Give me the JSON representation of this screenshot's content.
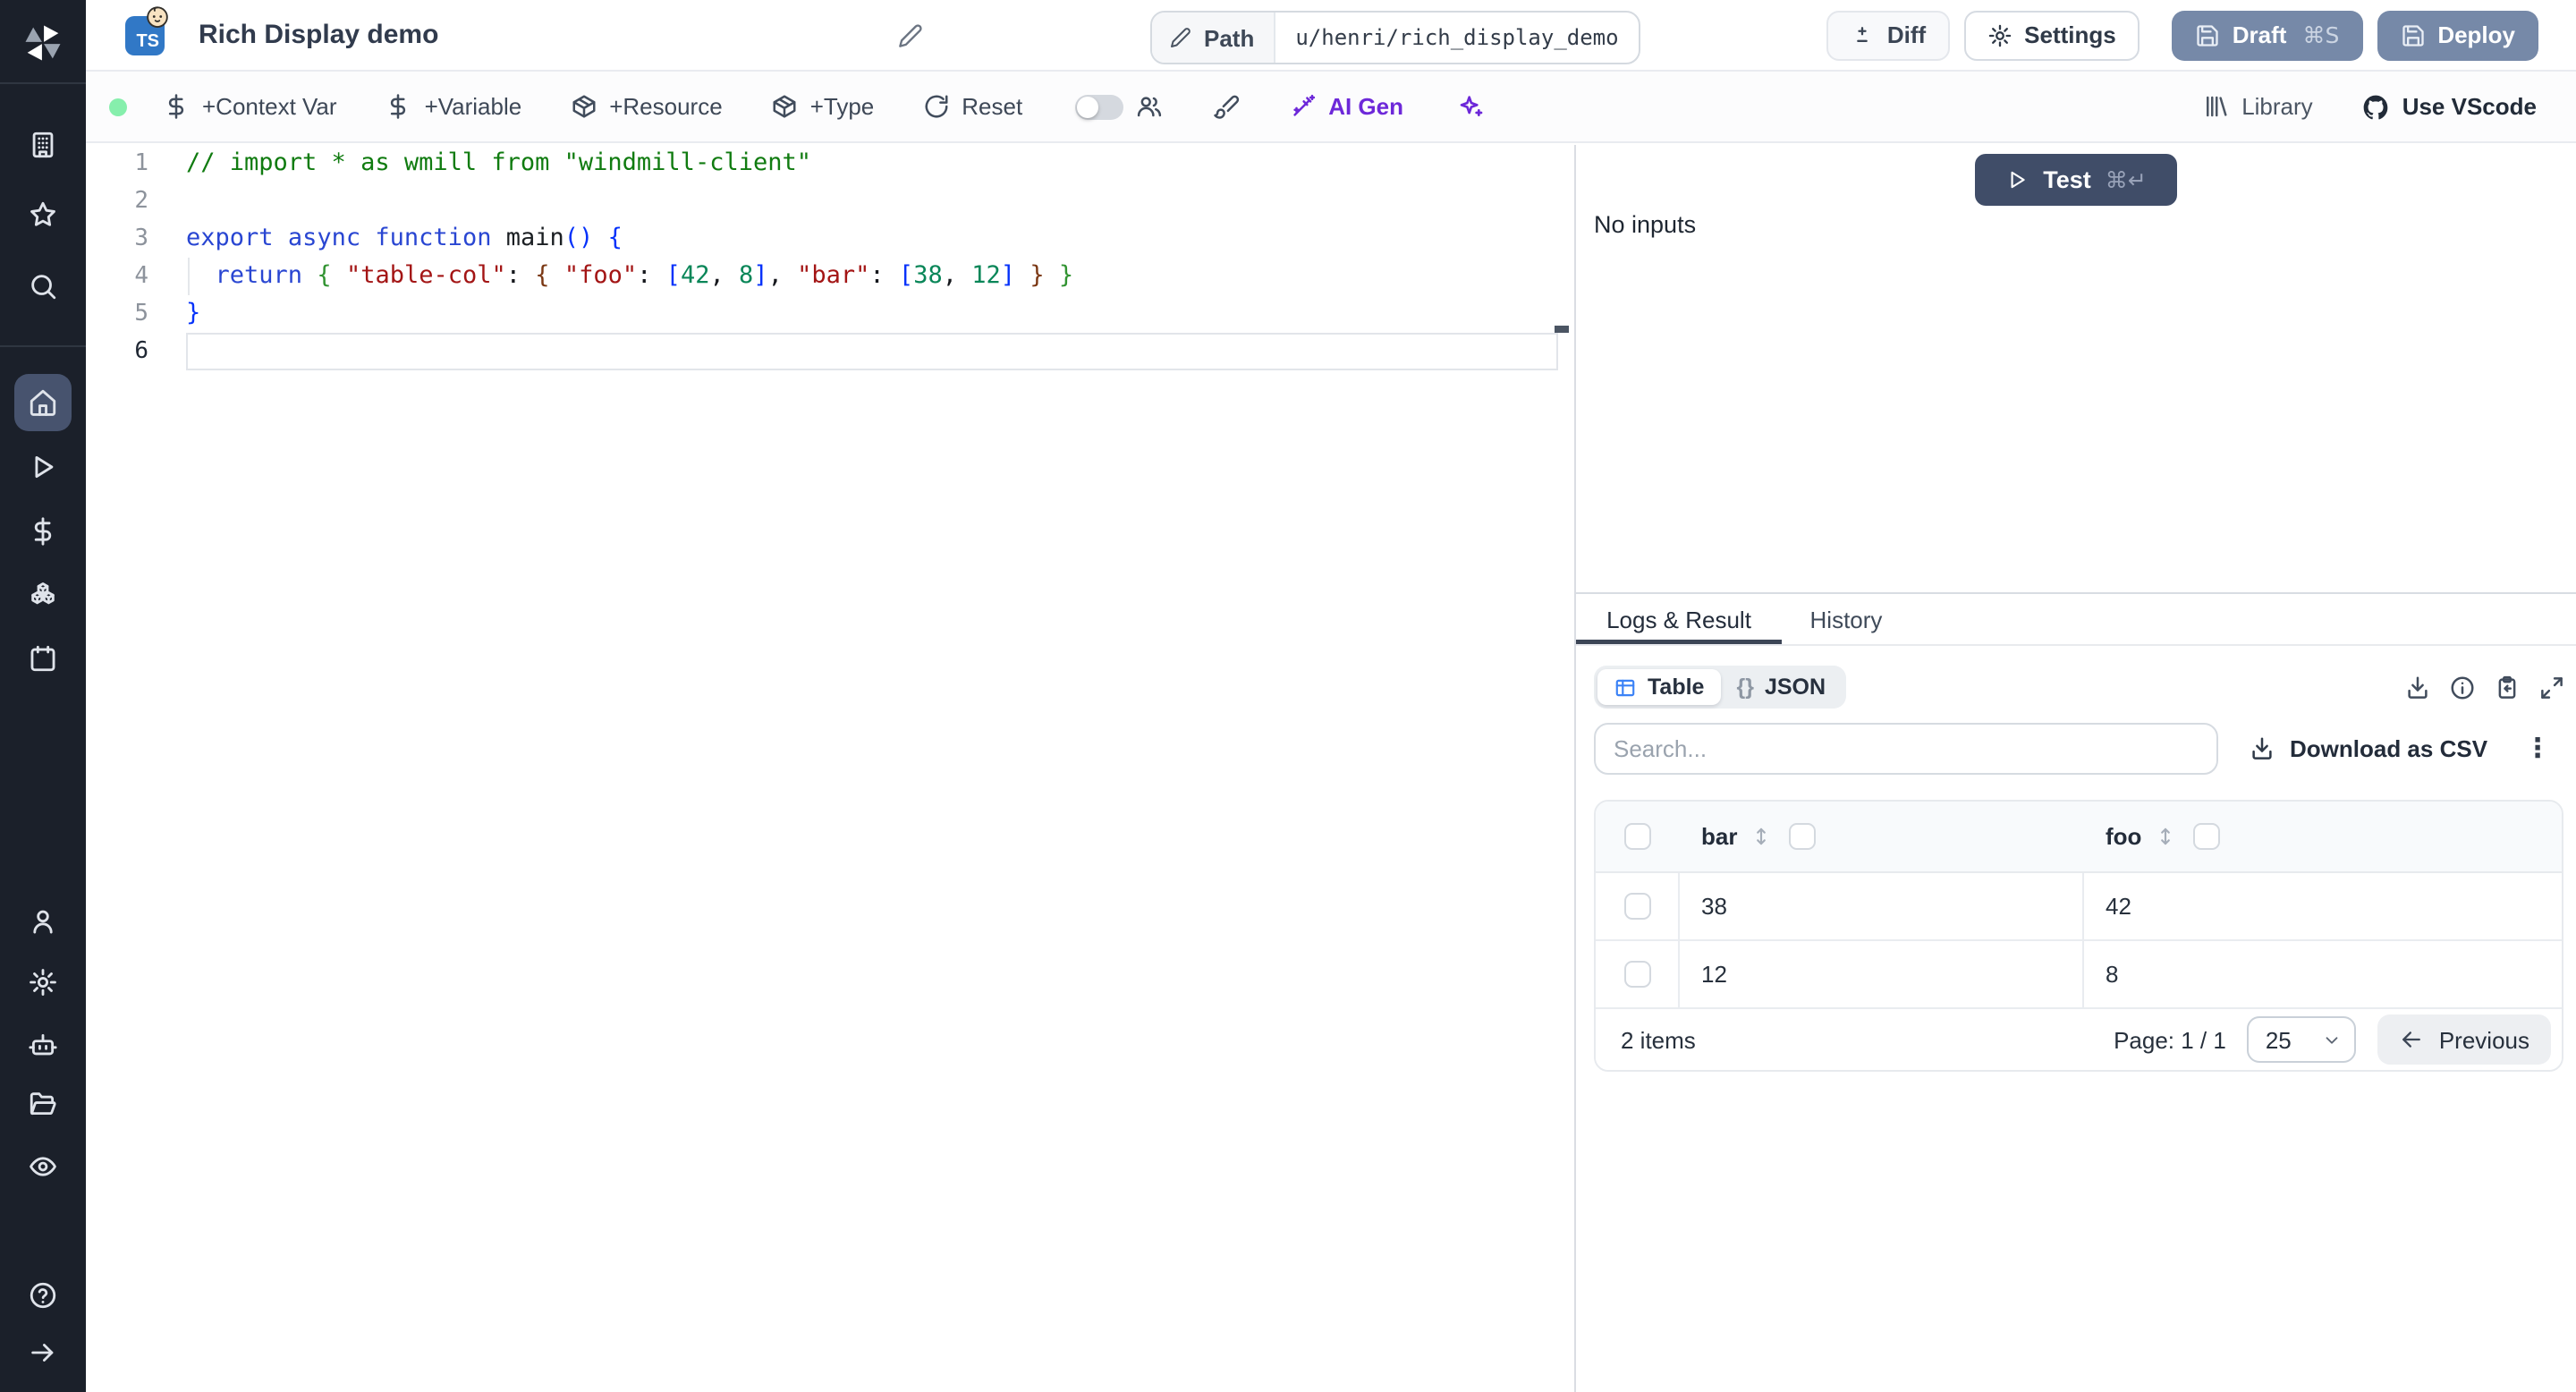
{
  "colors": {
    "sidebar_bg": "#1b202a",
    "slate": "#7689a8",
    "navy": "#404d68",
    "purple": "#6d28d9",
    "green_dot": "#86efac",
    "ts_blue": "#3178c6",
    "table_blue": "#3b82f6"
  },
  "sidebar": {
    "items": [
      {
        "icon": "logo",
        "name": "windmill-logo"
      },
      {
        "icon": "building",
        "name": "sidebar-item-workspace"
      },
      {
        "icon": "star",
        "name": "sidebar-item-favorites"
      },
      {
        "icon": "search",
        "name": "sidebar-item-search"
      },
      {
        "icon": "home",
        "name": "sidebar-item-home",
        "active": true
      },
      {
        "icon": "play",
        "name": "sidebar-item-runs"
      },
      {
        "icon": "dollar",
        "name": "sidebar-item-variables"
      },
      {
        "icon": "boxes",
        "name": "sidebar-item-resources"
      },
      {
        "icon": "calendar",
        "name": "sidebar-item-schedules"
      },
      {
        "icon": "user",
        "name": "sidebar-item-users"
      },
      {
        "icon": "gear",
        "name": "sidebar-item-settings"
      },
      {
        "icon": "bot",
        "name": "sidebar-item-workers"
      },
      {
        "icon": "folder-open",
        "name": "sidebar-item-folders"
      },
      {
        "icon": "eye",
        "name": "sidebar-item-audit-logs"
      },
      {
        "icon": "help",
        "name": "sidebar-item-help"
      },
      {
        "icon": "arrow-right",
        "name": "sidebar-item-expand"
      }
    ]
  },
  "header": {
    "language_badge": "TS",
    "title": "Rich Display demo",
    "path_label": "Path",
    "path_value": "u/henri/rich_display_demo",
    "diff": "Diff",
    "settings": "Settings",
    "draft": "Draft",
    "draft_shortcut": "⌘S",
    "deploy": "Deploy"
  },
  "toolbar": {
    "context_var": "+Context Var",
    "variable": "+Variable",
    "resource": "+Resource",
    "type": "+Type",
    "reset": "Reset",
    "ai_gen": "AI Gen",
    "library": "Library",
    "use_vscode": "Use VScode"
  },
  "editor": {
    "active_line": 6,
    "lines": [
      {
        "segs": [
          [
            "c",
            "// import * as wmill from \"windmill-client\""
          ]
        ]
      },
      {
        "segs": []
      },
      {
        "segs": [
          [
            "k",
            "export"
          ],
          [
            "p",
            " "
          ],
          [
            "k",
            "async"
          ],
          [
            "p",
            " "
          ],
          [
            "k",
            "function"
          ],
          [
            "p",
            " "
          ],
          [
            "i",
            "main"
          ],
          [
            "b1",
            "()"
          ],
          [
            "p",
            " "
          ],
          [
            "b1",
            "{"
          ]
        ]
      },
      {
        "segs": [
          [
            "p",
            "  "
          ],
          [
            "k",
            "return"
          ],
          [
            "p",
            " "
          ],
          [
            "b2",
            "{"
          ],
          [
            "p",
            " "
          ],
          [
            "s",
            "\"table-col\""
          ],
          [
            "p",
            ": "
          ],
          [
            "b3",
            "{"
          ],
          [
            "p",
            " "
          ],
          [
            "s",
            "\"foo\""
          ],
          [
            "p",
            ": "
          ],
          [
            "b1",
            "["
          ],
          [
            "n",
            "42"
          ],
          [
            "p",
            ", "
          ],
          [
            "n",
            "8"
          ],
          [
            "b1",
            "]"
          ],
          [
            "p",
            ", "
          ],
          [
            "s",
            "\"bar\""
          ],
          [
            "p",
            ": "
          ],
          [
            "b1",
            "["
          ],
          [
            "n",
            "38"
          ],
          [
            "p",
            ", "
          ],
          [
            "n",
            "12"
          ],
          [
            "b1",
            "]"
          ],
          [
            "p",
            " "
          ],
          [
            "b3",
            "}"
          ],
          [
            "p",
            " "
          ],
          [
            "b2",
            "}"
          ]
        ]
      },
      {
        "segs": [
          [
            "b1",
            "}"
          ]
        ]
      },
      {
        "segs": []
      }
    ]
  },
  "panel": {
    "test": "Test",
    "test_shortcut": "⌘↵",
    "no_inputs": "No inputs",
    "tab_logs": "Logs & Result",
    "tab_history": "History",
    "view_table": "Table",
    "view_json": "JSON",
    "braces": "{}",
    "search_placeholder": "Search...",
    "download_csv": "Download as CSV",
    "kebab": "⋮",
    "table": {
      "headers": [
        "bar",
        "foo"
      ],
      "rows": [
        [
          "38",
          "42"
        ],
        [
          "12",
          "8"
        ]
      ]
    },
    "items_count": "2 items",
    "page_label": "Page: 1 / 1",
    "page_size": "25",
    "previous": "Previous"
  }
}
